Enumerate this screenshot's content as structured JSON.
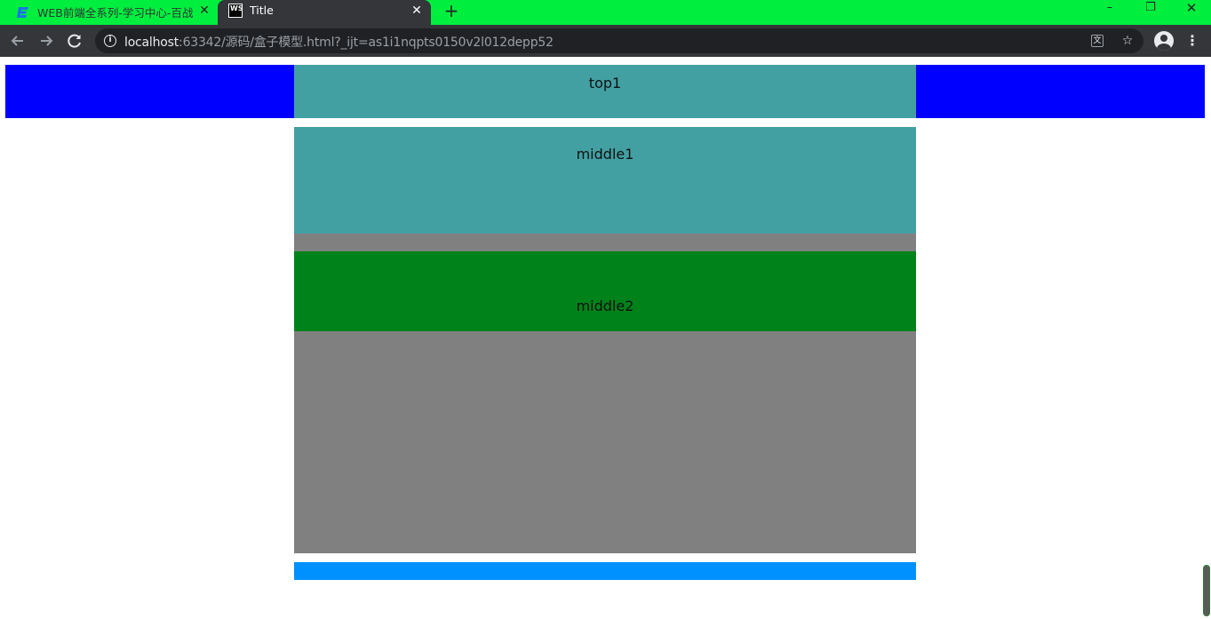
{
  "browser": {
    "tabs": [
      {
        "title": "WEB前端全系列-学习中心-百战",
        "active": false
      },
      {
        "title": "Title",
        "active": true
      }
    ],
    "new_tab_label": "+",
    "window_controls": {
      "minimize": "–",
      "maximize": "❐",
      "close": "✕"
    },
    "close_glyph": "✕",
    "favicon_ws": "WS",
    "url_host": "localhost",
    "url_rest": ":63342/源码/盒子模型.html?_ijt=as1i1nqpts0150v2l012depp52",
    "icons": [
      "back-arrow-icon",
      "forward-arrow-icon",
      "reload-icon",
      "info-icon",
      "translate-icon",
      "star-icon",
      "account-icon",
      "menu-icon"
    ]
  },
  "page": {
    "top_label": "top1",
    "middle1_label": "middle1",
    "middle2_label": "middle2"
  },
  "colors": {
    "tabbar": "#00ef3f",
    "top_outer": "#0000ff",
    "top_inner": "#42a0a2",
    "middle_wrap": "#808080",
    "middle1": "#42a0a2",
    "middle2": "#00821a",
    "bottom": "#0091ff"
  }
}
